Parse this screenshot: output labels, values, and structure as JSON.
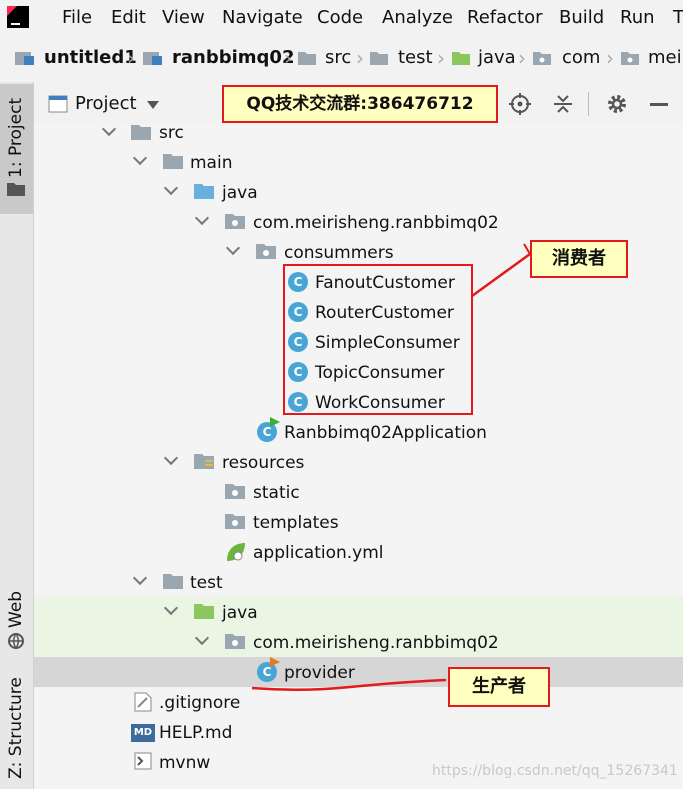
{
  "menubar": {
    "items": [
      "File",
      "Edit",
      "View",
      "Navigate",
      "Code",
      "Analyze",
      "Refactor",
      "Build",
      "Run",
      "T"
    ]
  },
  "breadcrumb": {
    "items": [
      "untitled1",
      "ranbbimq02",
      "src",
      "test",
      "java",
      "com",
      "meir"
    ]
  },
  "left_strip": {
    "project_tab": "1: Project",
    "web_tab": "Web",
    "structure_tab": "Z: Structure"
  },
  "panel": {
    "view_label": "Project",
    "banner": "QQ技术交流群:386476712"
  },
  "tree": {
    "items": [
      "src",
      "main",
      "java",
      "com.meirisheng.ranbbimq02",
      "consummers",
      "FanoutCustomer",
      "RouterCustomer",
      "SimpleConsumer",
      "TopicConsumer",
      "WorkConsumer",
      "Ranbbimq02Application",
      "resources",
      "static",
      "templates",
      "application.yml",
      "test",
      "java",
      "com.meirisheng.ranbbimq02",
      "provider",
      ".gitignore",
      "HELP.md",
      "mvnw"
    ],
    "md_badge": "MD",
    "class_badge": "C"
  },
  "annotations": {
    "consumer_label": "消费者",
    "producer_label": "生产者"
  },
  "watermark": "https://blog.csdn.net/qq_15267341",
  "colors": {
    "annotation_red": "#e3191c",
    "callout_fill": "#ffffc0",
    "class_icon": "#48a6d6",
    "source_folder": "#6ab0de",
    "test_folder": "#8cc65f",
    "test_row_bg": "#eaf5e4",
    "selected_row_bg": "#d6d6d6"
  }
}
